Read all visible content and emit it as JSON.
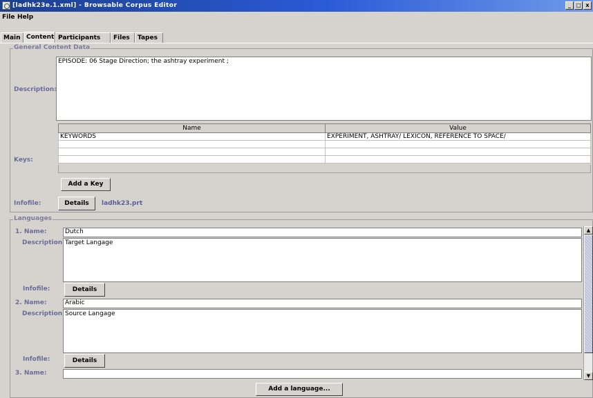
{
  "window": {
    "title": "[ladhk23e.1.xml] - Browsable Corpus Editor",
    "controls": {
      "minimize": "_",
      "maximize": "□",
      "close": "x"
    }
  },
  "menu": {
    "items": [
      "File",
      "Help"
    ]
  },
  "tabs": {
    "items": [
      "Main",
      "Content",
      "Participants",
      "Files",
      "Tapes"
    ],
    "active": "Content"
  },
  "general": {
    "title": "General Content Data",
    "description_label": "Description:",
    "description_value": "EPISODE: 06 Stage Direction; the ashtray experiment ;",
    "keys_label": "Keys:",
    "keys_table": {
      "columns": [
        "Name",
        "Value"
      ],
      "rows": [
        [
          "KEYWORDS",
          "EXPERIMENT, ASHTRAY/ LEXICON, REFERENCE TO SPACE/"
        ],
        [
          "",
          ""
        ],
        [
          "",
          ""
        ],
        [
          "",
          ""
        ]
      ]
    },
    "add_key_label": "Add a Key",
    "infofile_label": "Infofile:",
    "details_label": "Details",
    "infofile_name": "ladhk23.prt"
  },
  "languages": {
    "title": "Languages",
    "items": [
      {
        "name_label": "1. Name:",
        "name": "Dutch",
        "description_label": "Description:",
        "description": "Target Langage",
        "infofile_label": "Infofile:",
        "details_label": "Details"
      },
      {
        "name_label": "2. Name:",
        "name": "Arabic",
        "description_label": "Description:",
        "description": "Source Langage",
        "infofile_label": "Infofile:",
        "details_label": "Details"
      },
      {
        "name_label": "3. Name:",
        "name": ""
      }
    ],
    "add_language_label": "Add a language...",
    "scroll": {
      "up": "▲",
      "down": "▼"
    }
  }
}
